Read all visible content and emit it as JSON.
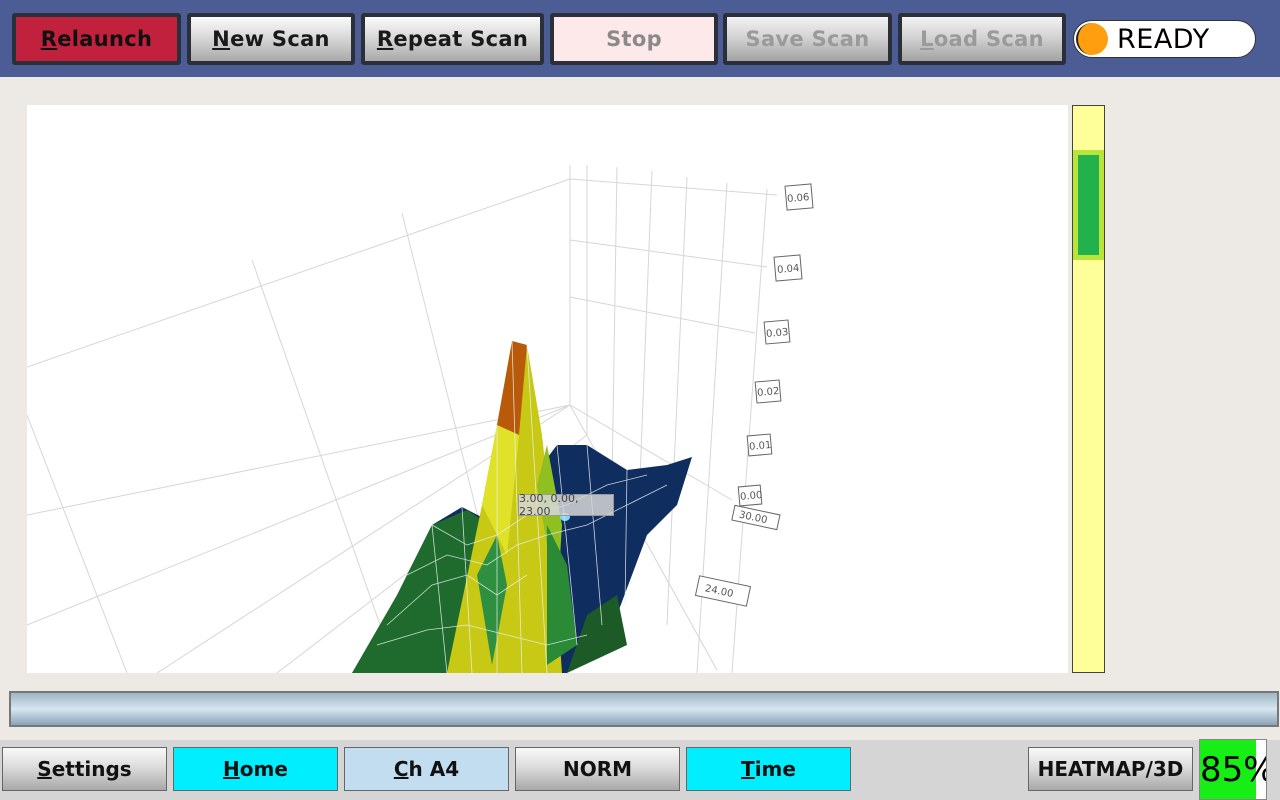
{
  "toolbar": {
    "relaunch": {
      "first": "R",
      "rest": "elaunch"
    },
    "new_scan": {
      "first": "N",
      "rest": "ew Scan"
    },
    "repeat_scan": {
      "first": "R",
      "rest": "epeat Scan"
    },
    "stop": "Stop",
    "save_scan": "Save Scan",
    "load_scan": {
      "first": "L",
      "rest": "oad Scan"
    },
    "status": "READY"
  },
  "plot": {
    "z_labels": [
      "0.06",
      "0.04",
      "0.03",
      "0.02",
      "0.01",
      "0.00"
    ],
    "x_labels": [
      "30.00",
      "24.00"
    ],
    "tooltip": "3.00, 0.00, 23.00"
  },
  "bottom": {
    "settings": {
      "first": "S",
      "rest": "ettings"
    },
    "home": {
      "first": "H",
      "rest": "ome"
    },
    "channel": {
      "first": "C",
      "rest": "h A4"
    },
    "norm": "NORM",
    "time": {
      "first": "T",
      "rest": "ime"
    },
    "view_mode": "HEATMAP/3D",
    "percent_text": "85%",
    "percent_value": 85
  },
  "colors": {
    "toolbar_bg": "#4c5d96",
    "relaunch": "#c1213d",
    "status_dot": "#ff9f10",
    "cyan_button": "#00eeff",
    "slider_track": "#ffff99",
    "slider_thumb": "#22b14c",
    "percent_fill": "#16ee16"
  }
}
